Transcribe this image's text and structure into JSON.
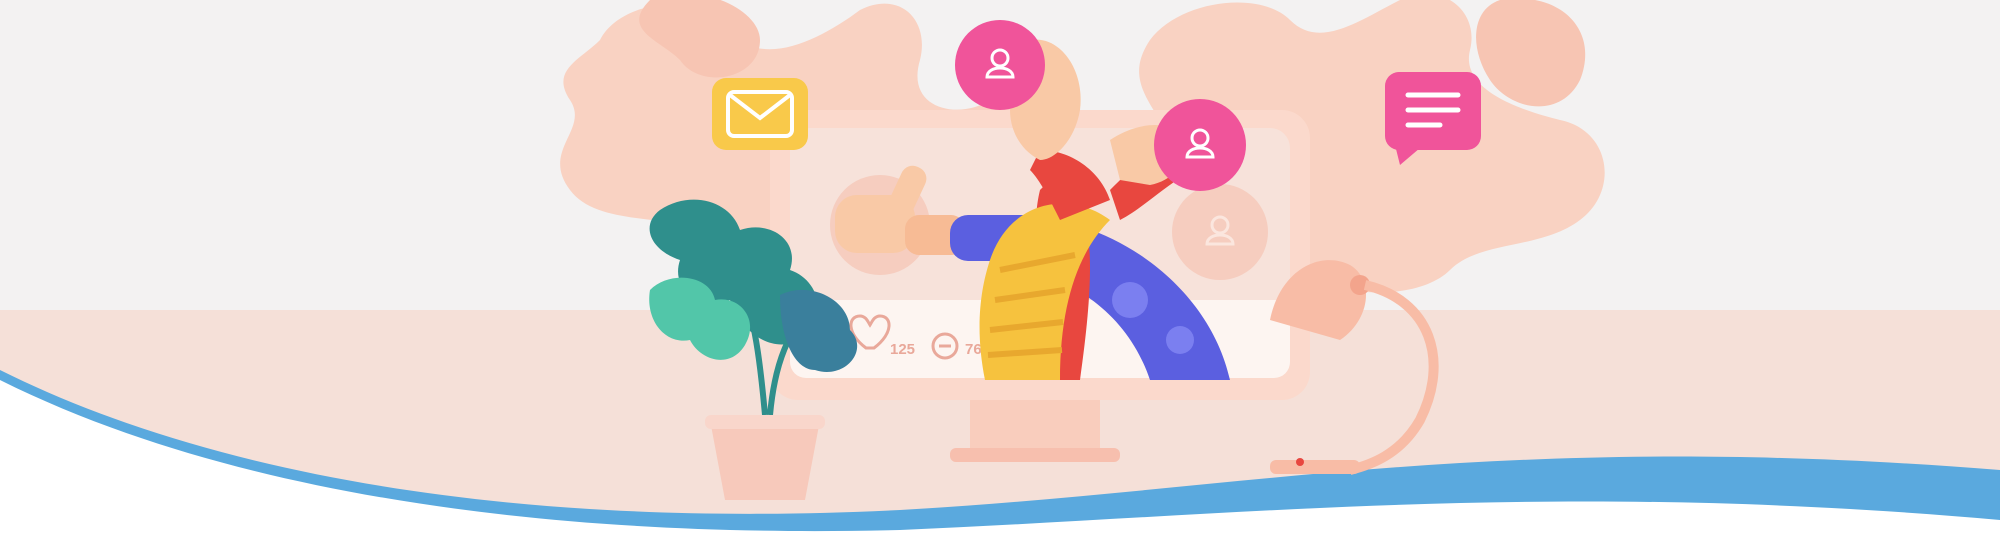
{
  "scene": {
    "description_tag": "social-media-illustration-banner",
    "colors": {
      "sky": "#f3f2f2",
      "floor": "#f5e0d8",
      "blob": "#f9d2c2",
      "blob_shadow": "#f2b9a6",
      "screen_frame": "#fbd9cc",
      "screen_bg": "#f7e2da",
      "screen_white": "#fdf5f1",
      "wave_blue": "#5aa9de",
      "wave_white": "#ffffff",
      "pink_badge": "#f0549a",
      "yellow_icon": "#f9c94a",
      "plant_teal": "#2f8f8c",
      "plant_mint": "#52c6a9",
      "pot": "#f7c9bb",
      "lamp": "#f8bca6",
      "sleeve_red": "#e8473f",
      "sleeve_yellow": "#f6c23e",
      "sleeve_blue": "#5b5fe0",
      "skin": "#f9c9a6",
      "stat_text": "#e9a89a"
    },
    "icons": {
      "mail": "mail-icon",
      "chat": "chat-message-icon",
      "user_badge_1": "user-icon",
      "user_badge_2": "user-icon",
      "user_badge_faded": "user-icon",
      "like": "heart-icon",
      "comment": "comment-icon"
    },
    "stats": {
      "likes": "125",
      "comments": "76"
    }
  }
}
